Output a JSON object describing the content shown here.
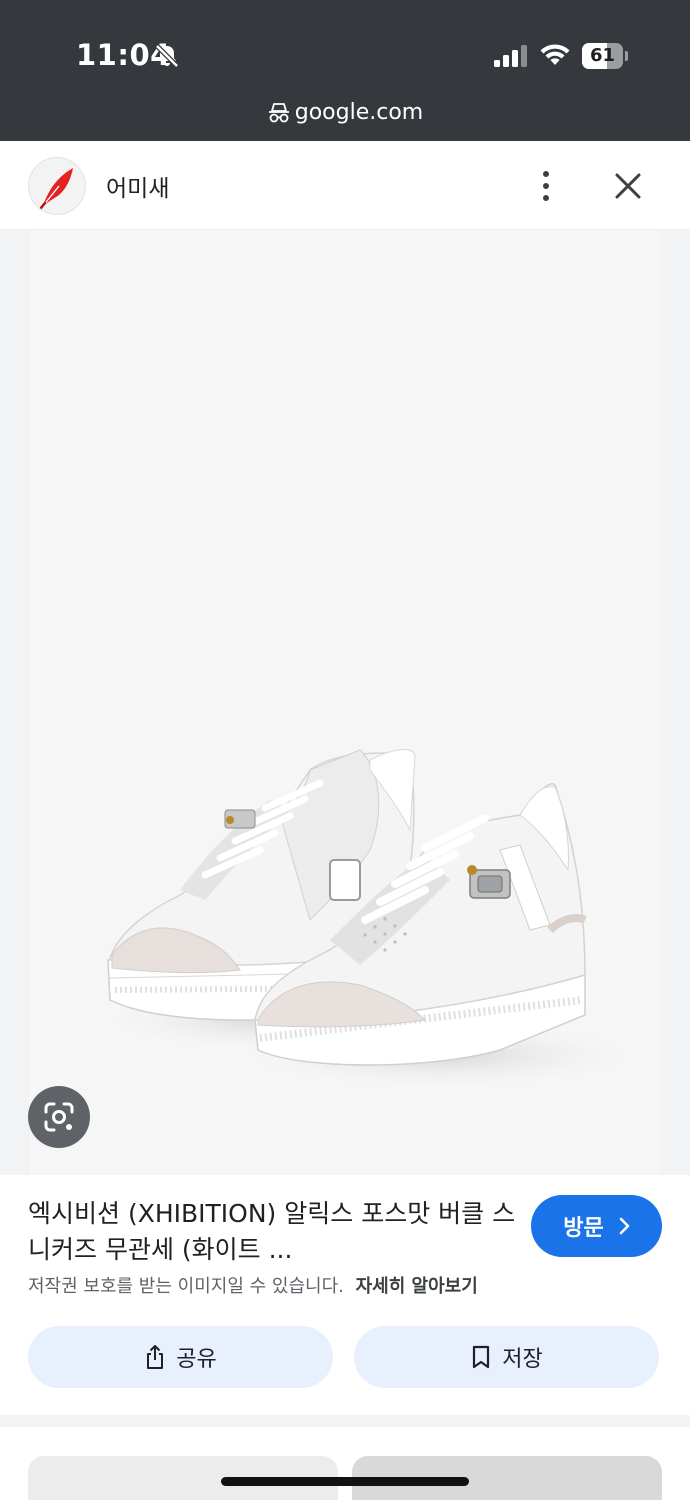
{
  "status_bar": {
    "time": "11:04",
    "battery_level": 61,
    "battery_label": "61",
    "icons": [
      "bell-slash-icon",
      "cellular-signal-icon",
      "wifi-icon",
      "battery-icon"
    ]
  },
  "browser": {
    "url": "google.com",
    "mode_icon": "incognito-icon"
  },
  "header": {
    "site_name": "어미새",
    "menu_icon": "more-vertical-icon",
    "close_icon": "close-icon"
  },
  "image": {
    "lens_icon": "google-lens-icon"
  },
  "result": {
    "title": "엑시비션 (XHIBITION) 알릭스 포스맛 버클 스니커즈 무관세 (화이트 ...",
    "visit_label": "방문",
    "copyright_notice": "저작권 보호를 받는 이미지일 수 있습니다.",
    "learn_more": "자세히 알아보기"
  },
  "actions": {
    "share_label": "공유",
    "save_label": "저장"
  },
  "colors": {
    "accent": "#1a73e8",
    "top_bar": "#35383c",
    "action_button_bg": "#e8f0fe",
    "logo_feather": "#e52222"
  }
}
